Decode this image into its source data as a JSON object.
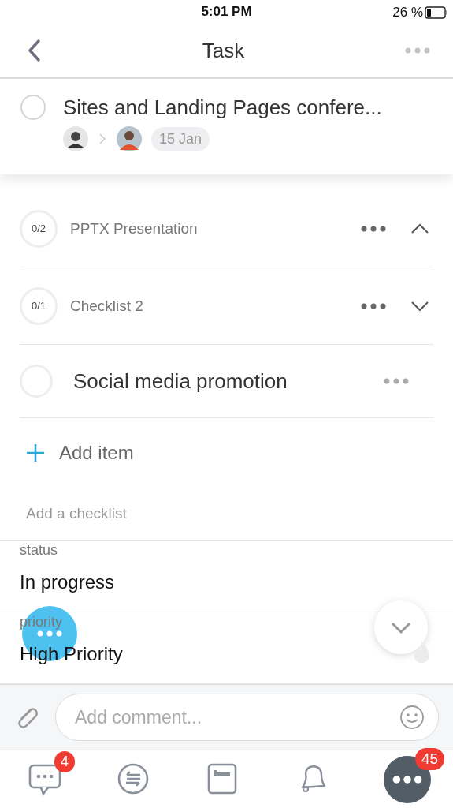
{
  "status_bar": {
    "time": "5:01 PM",
    "battery": "26 %"
  },
  "nav": {
    "title": "Task"
  },
  "task": {
    "title": "Sites and Landing Pages confere...",
    "done": false,
    "date": "15 Jan"
  },
  "checklists": [
    {
      "kind": "checklist",
      "count": "0/2",
      "title": "PPTX Presentation",
      "expanded": true
    },
    {
      "kind": "checklist",
      "count": "0/1",
      "title": "Checklist 2",
      "expanded": false
    },
    {
      "kind": "item",
      "title": "Social media promotion",
      "checked": false
    }
  ],
  "add_item": {
    "label": "Add item"
  },
  "add_checklist": {
    "label": "Add a checklist"
  },
  "fields": [
    {
      "label": "status",
      "value": "In progress"
    },
    {
      "label": "priority",
      "value": "High Priority"
    }
  ],
  "comment": {
    "placeholder": "Add comment..."
  },
  "tab_bar": [
    {
      "kind": "chat",
      "badge": "4"
    },
    {
      "kind": "exchange"
    },
    {
      "kind": "card"
    },
    {
      "kind": "bell"
    },
    {
      "kind": "more",
      "badge": "45"
    }
  ]
}
